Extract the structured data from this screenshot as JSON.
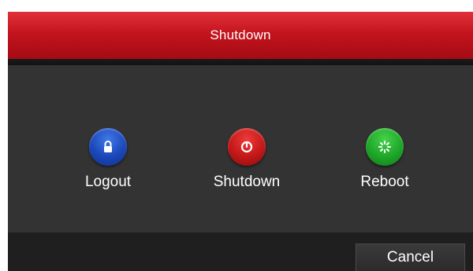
{
  "dialog": {
    "title": "Shutdown"
  },
  "actions": [
    {
      "label": "Logout",
      "icon": "lock-icon",
      "color": "#1b47b8"
    },
    {
      "label": "Shutdown",
      "icon": "power-icon",
      "color": "#c21818"
    },
    {
      "label": "Reboot",
      "icon": "reboot-icon",
      "color": "#1ea628"
    }
  ],
  "footer": {
    "cancel_label": "Cancel"
  }
}
